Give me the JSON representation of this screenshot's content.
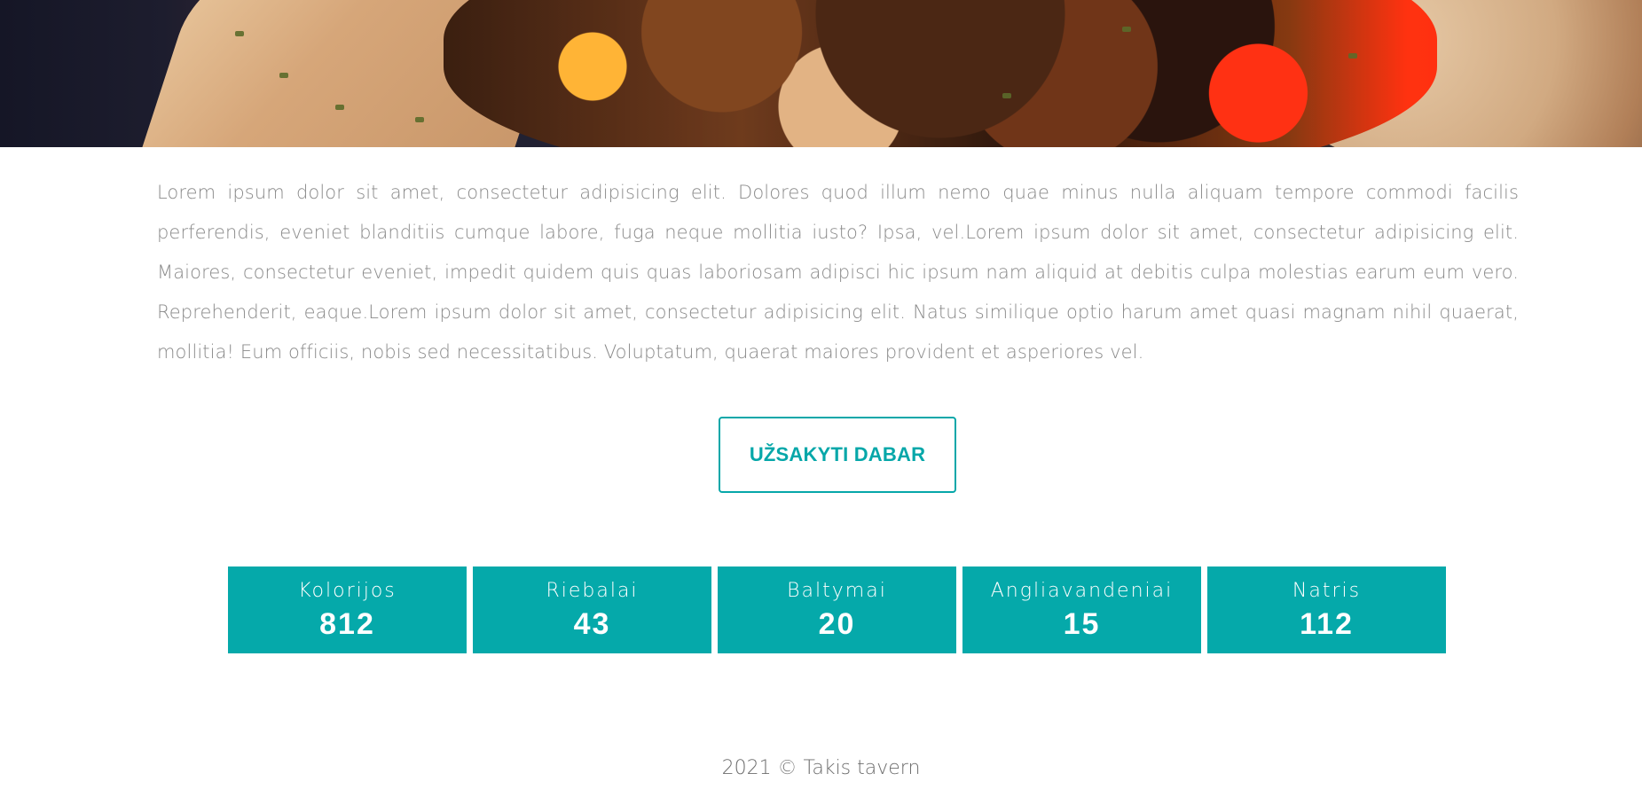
{
  "hero": {
    "image_subject": "grilled-gyros-plate"
  },
  "content": {
    "paragraph": "Lorem ipsum dolor sit amet, consectetur adipisicing elit. Dolores quod illum nemo quae minus nulla aliquam tempore commodi facilis perferendis, eveniet blanditiis cumque labore, fuga neque mollitia iusto? Ipsa, vel.Lorem ipsum dolor sit amet, consectetur adipisicing elit. Maiores, consectetur eveniet, impedit quidem quis quas laboriosam adipisci hic ipsum nam aliquid at debitis culpa molestias earum eum vero. Reprehenderit, eaque.Lorem ipsum dolor sit amet, consectetur adipisicing elit. Natus similique optio harum amet quasi magnam nihil quaerat, mollitia! Eum officiis, nobis sed necessitatibus. Voluptatum, quaerat maiores provident et asperiores vel."
  },
  "cta": {
    "label": "UŽSAKYTI DABAR"
  },
  "nutrition": [
    {
      "label": "Kolorijos",
      "value": "812"
    },
    {
      "label": "Riebalai",
      "value": "43"
    },
    {
      "label": "Baltymai",
      "value": "20"
    },
    {
      "label": "Angliavandeniai",
      "value": "15"
    },
    {
      "label": "Natris",
      "value": "112"
    }
  ],
  "footer": {
    "text": "2021 © Takis tavern"
  },
  "colors": {
    "accent": "#05a9aa",
    "text_muted": "#8a8a8a"
  }
}
